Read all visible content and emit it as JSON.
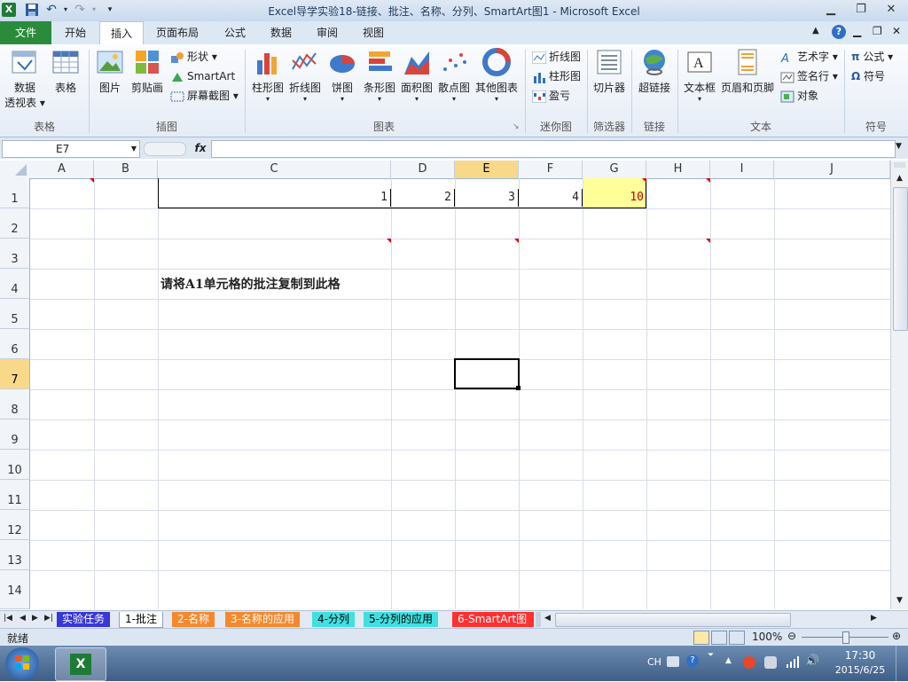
{
  "window": {
    "title": "Excel导学实验18-链接、批注、名称、分列、SmartArt图1 - Microsoft Excel",
    "app_icon": "X"
  },
  "ribbon_tabs": [
    "文件",
    "开始",
    "插入",
    "页面布局",
    "公式",
    "数据",
    "审阅",
    "视图"
  ],
  "active_tab": "插入",
  "ribbon": {
    "groups": {
      "tables": "表格",
      "illustrations": "插图",
      "charts": "图表",
      "sparklines": "迷你图",
      "filter": "筛选器",
      "links": "链接",
      "text": "文本",
      "symbols": "符号"
    },
    "buttons": {
      "pivot_line1": "数据",
      "pivot_line2": "透视表",
      "table": "表格",
      "picture": "图片",
      "clipart": "剪贴画",
      "shapes": "形状",
      "smartart": "SmartArt",
      "screenshot": "屏幕截图",
      "column": "柱形图",
      "line": "折线图",
      "pie": "饼图",
      "bar": "条形图",
      "area": "面积图",
      "scatter": "散点图",
      "other": "其他图表",
      "spark_line": "折线图",
      "spark_column": "柱形图",
      "spark_winloss": "盈亏",
      "slicer": "切片器",
      "hyperlink": "超链接",
      "textbox": "文本框",
      "header_footer": "页眉和页脚",
      "wordart": "艺术字",
      "signature": "签名行",
      "object": "对象",
      "equation": "公式",
      "symbol": "符号"
    }
  },
  "formula_bar": {
    "name_box": "E7",
    "fx": "fx",
    "content": ""
  },
  "columns": [
    "A",
    "B",
    "C",
    "D",
    "E",
    "F",
    "G",
    "H",
    "I",
    "J"
  ],
  "rows": [
    "1",
    "2",
    "3",
    "4",
    "5",
    "6",
    "7",
    "8",
    "9",
    "10",
    "11",
    "12",
    "13",
    "14"
  ],
  "selected_cell": "E7",
  "cells": {
    "C1": "1",
    "D1": "2",
    "E1": "3",
    "F1": "4",
    "G1": "10",
    "C4": "请将A1单元格的批注复制到此格"
  },
  "sheet_tabs": [
    "实验任务",
    "1-批注",
    "2-名称",
    "3-名称的应用",
    "4-分列",
    "5-分列的应用",
    "6-SmartArt图"
  ],
  "active_sheet": "1-批注",
  "status": {
    "ready": "就绪",
    "zoom": "100%"
  },
  "taskbar": {
    "ime": "CH",
    "time": "17:30",
    "date": "2015/6/25"
  },
  "colors": {
    "g1_fill": "#ffff99",
    "g1_text": "#c00000",
    "comment_marker": "#d40000",
    "file_tab": "#2a8c3b"
  }
}
